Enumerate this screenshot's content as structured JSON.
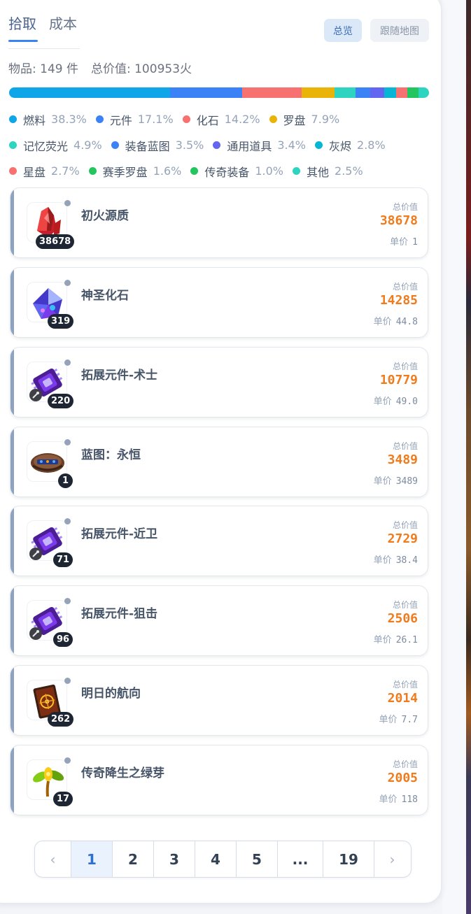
{
  "tabs": [
    {
      "label": "拾取",
      "active": true
    },
    {
      "label": "成本",
      "active": false
    }
  ],
  "buttons": {
    "overview": "总览",
    "follow_map": "跟随地图"
  },
  "stats": {
    "items": "物品: 149 件",
    "total": "总价值: 100953火"
  },
  "categories": [
    {
      "name": "燃料",
      "pct": "38.3%",
      "value": 38.3,
      "color": "#0ea5e9"
    },
    {
      "name": "元件",
      "pct": "17.1%",
      "value": 17.1,
      "color": "#3b82f6"
    },
    {
      "name": "化石",
      "pct": "14.2%",
      "value": 14.2,
      "color": "#f87171"
    },
    {
      "name": "罗盘",
      "pct": "7.9%",
      "value": 7.9,
      "color": "#eab308"
    },
    {
      "name": "记忆荧光",
      "pct": "4.9%",
      "value": 4.9,
      "color": "#2dd4bf"
    },
    {
      "name": "装备蓝图",
      "pct": "3.5%",
      "value": 3.5,
      "color": "#3b82f6"
    },
    {
      "name": "通用道具",
      "pct": "3.4%",
      "value": 3.4,
      "color": "#6366f1"
    },
    {
      "name": "灰烬",
      "pct": "2.8%",
      "value": 2.8,
      "color": "#06b6d4"
    },
    {
      "name": "星盘",
      "pct": "2.7%",
      "value": 2.7,
      "color": "#f87171"
    },
    {
      "name": "赛季罗盘",
      "pct": "1.6%",
      "value": 1.6,
      "color": "#22c55e"
    },
    {
      "name": "传奇装备",
      "pct": "1.0%",
      "value": 1.0,
      "color": "#22c55e"
    },
    {
      "name": "其他",
      "pct": "2.5%",
      "value": 2.5,
      "color": "#2dd4bf"
    }
  ],
  "items": [
    {
      "name": "初火源质",
      "qty": "38678",
      "total_label": "总价值",
      "total": "38678",
      "unit_label": "单价",
      "unit": "1",
      "icon": "red-crystal-icon"
    },
    {
      "name": "神圣化石",
      "qty": "319",
      "total_label": "总价值",
      "total": "14285",
      "unit_label": "单价",
      "unit": "44.8",
      "icon": "fossil-crystal-icon"
    },
    {
      "name": "拓展元件-术士",
      "qty": "220",
      "total_label": "总价值",
      "total": "10779",
      "unit_label": "单价",
      "unit": "49.0",
      "icon": "chip-icon"
    },
    {
      "name": "蓝图：永恒",
      "qty": "1",
      "total_label": "总价值",
      "total": "3489",
      "unit_label": "单价",
      "unit": "3489",
      "icon": "blueprint-icon"
    },
    {
      "name": "拓展元件-近卫",
      "qty": "71",
      "total_label": "总价值",
      "total": "2729",
      "unit_label": "单价",
      "unit": "38.4",
      "icon": "chip-icon"
    },
    {
      "name": "拓展元件-狙击",
      "qty": "96",
      "total_label": "总价值",
      "total": "2506",
      "unit_label": "单价",
      "unit": "26.1",
      "icon": "chip-icon"
    },
    {
      "name": "明日的航向",
      "qty": "262",
      "total_label": "总价值",
      "total": "2014",
      "unit_label": "单价",
      "unit": "7.7",
      "icon": "compass-card-icon"
    },
    {
      "name": "传奇降生之绿芽",
      "qty": "17",
      "total_label": "总价值",
      "total": "2005",
      "unit_label": "单价",
      "unit": "118",
      "icon": "sprout-icon"
    }
  ],
  "pagination": {
    "prev": "‹",
    "pages": [
      "1",
      "2",
      "3",
      "4",
      "5",
      "...",
      "19"
    ],
    "current": "1",
    "next": "›"
  }
}
